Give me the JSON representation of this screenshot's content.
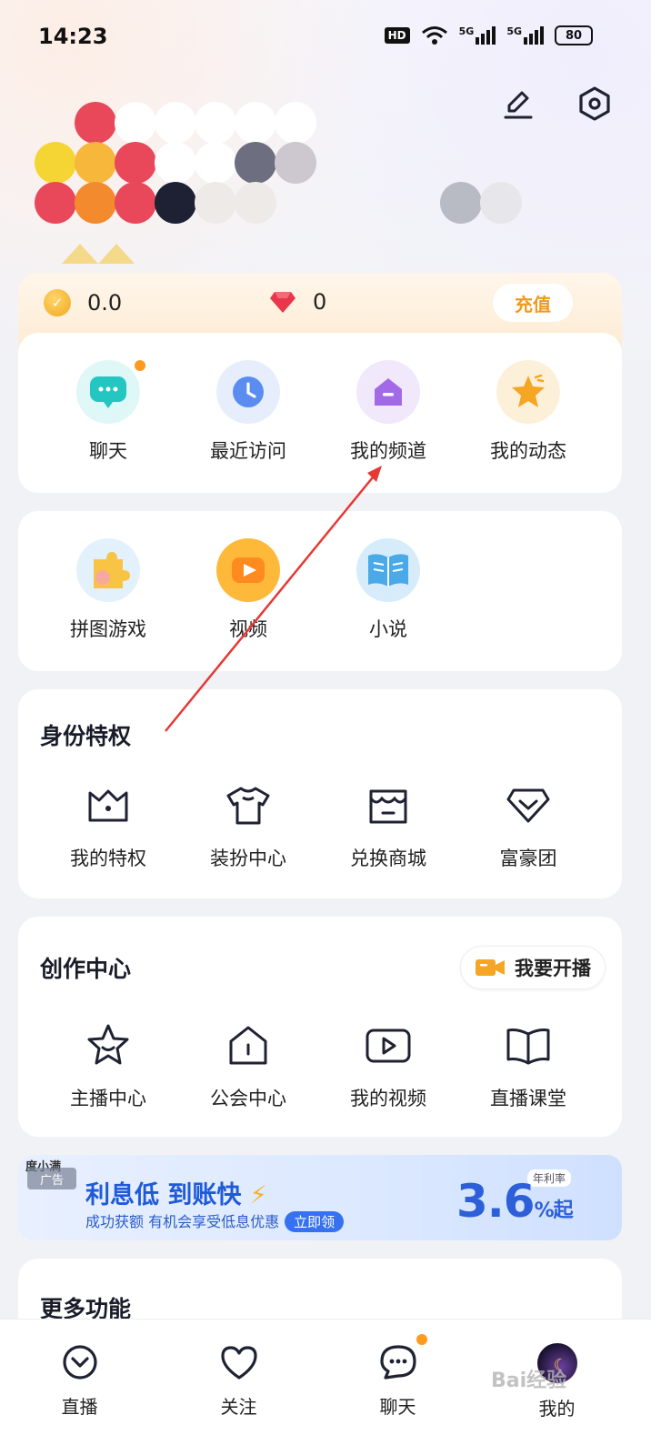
{
  "status_bar": {
    "time": "14:23",
    "hd": "HD",
    "net1": "5G",
    "net2": "5G",
    "battery": "80"
  },
  "wallet": {
    "coins": "0.0",
    "diamonds": "0",
    "recharge_label": "充值"
  },
  "shortcuts": [
    {
      "label": "聊天",
      "icon": "chat-bubble-icon",
      "has_dot": true
    },
    {
      "label": "最近访问",
      "icon": "clock-icon"
    },
    {
      "label": "我的频道",
      "icon": "channel-home-icon"
    },
    {
      "label": "我的动态",
      "icon": "star-icon"
    }
  ],
  "apps": [
    {
      "label": "拼图游戏",
      "icon": "puzzle-icon"
    },
    {
      "label": "视频",
      "icon": "play-icon"
    },
    {
      "label": "小说",
      "icon": "book-icon"
    }
  ],
  "identity": {
    "title": "身份特权",
    "items": [
      {
        "label": "我的特权",
        "icon": "crown-icon"
      },
      {
        "label": "装扮中心",
        "icon": "tshirt-icon"
      },
      {
        "label": "兑换商城",
        "icon": "shop-icon"
      },
      {
        "label": "富豪团",
        "icon": "diamond-icon"
      }
    ]
  },
  "creation": {
    "title": "创作中心",
    "broadcast_label": "我要开播",
    "items": [
      {
        "label": "主播中心",
        "icon": "star-outline-icon"
      },
      {
        "label": "公会中心",
        "icon": "guild-home-icon"
      },
      {
        "label": "我的视频",
        "icon": "video-play-icon"
      },
      {
        "label": "直播课堂",
        "icon": "open-book-icon"
      }
    ]
  },
  "ad": {
    "brand": "度小满",
    "badge": "广告",
    "headline": "利息低 到账快",
    "sub": "成功获额 有机会享受低息优惠",
    "cta": "立即领",
    "rate_label": "年利率",
    "rate": "3.6",
    "rate_suffix": "%起"
  },
  "more": {
    "title": "更多功能"
  },
  "tabbar": [
    {
      "label": "直播",
      "icon": "live-icon"
    },
    {
      "label": "关注",
      "icon": "heart-icon"
    },
    {
      "label": "聊天",
      "icon": "chat-icon",
      "has_dot": true
    },
    {
      "label": "我的",
      "icon": "avatar-icon"
    }
  ],
  "watermark": "Bai经验",
  "colors": {
    "accent": "#f09a1a",
    "brand_blue": "#2d5fd8",
    "arrow_red": "#e53935"
  }
}
